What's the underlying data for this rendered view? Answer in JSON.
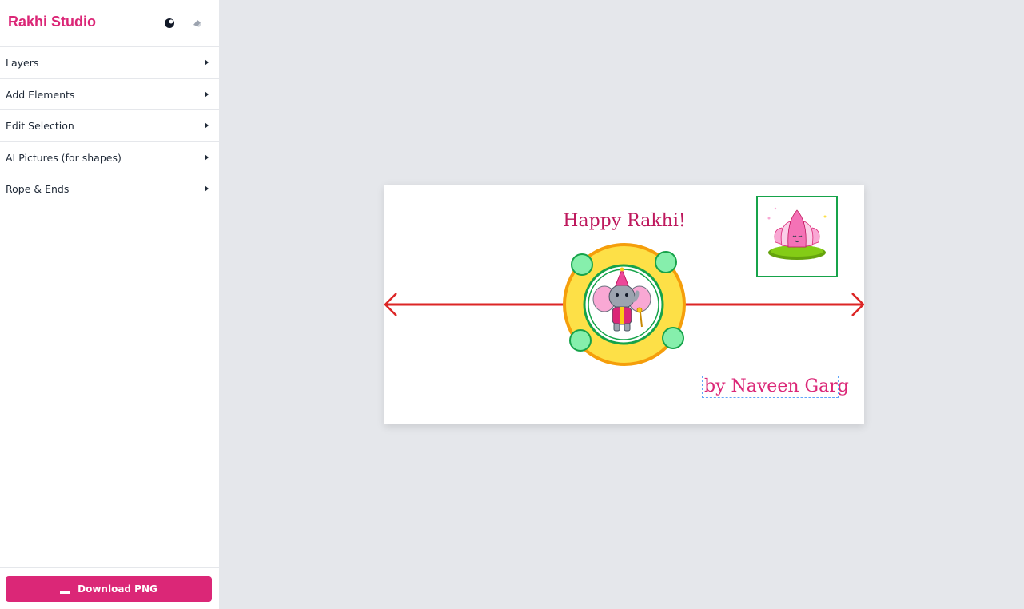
{
  "app": {
    "title": "Rakhi Studio",
    "brand_color": "#db2777"
  },
  "header": {
    "theme_icon": "half-moon-icon",
    "reset_icon": "eraser-icon"
  },
  "sidebar": {
    "items": [
      {
        "label": "Layers"
      },
      {
        "label": "Add Elements"
      },
      {
        "label": "Edit Selection"
      },
      {
        "label": "AI Pictures (for shapes)"
      },
      {
        "label": "Rope & Ends"
      }
    ]
  },
  "footer": {
    "download_label": "Download PNG",
    "download_icon": "download-icon"
  },
  "canvas": {
    "title": "Happy Rakhi!",
    "byline": "by Naveen Garg",
    "rope_color": "#dc2626",
    "disc_fill": "#fde047",
    "disc_stroke": "#f59e0b",
    "bead_fill": "#86efac",
    "bead_stroke": "#16a34a",
    "center_image": "elephant-image",
    "sticker_image": "lotus-image"
  }
}
